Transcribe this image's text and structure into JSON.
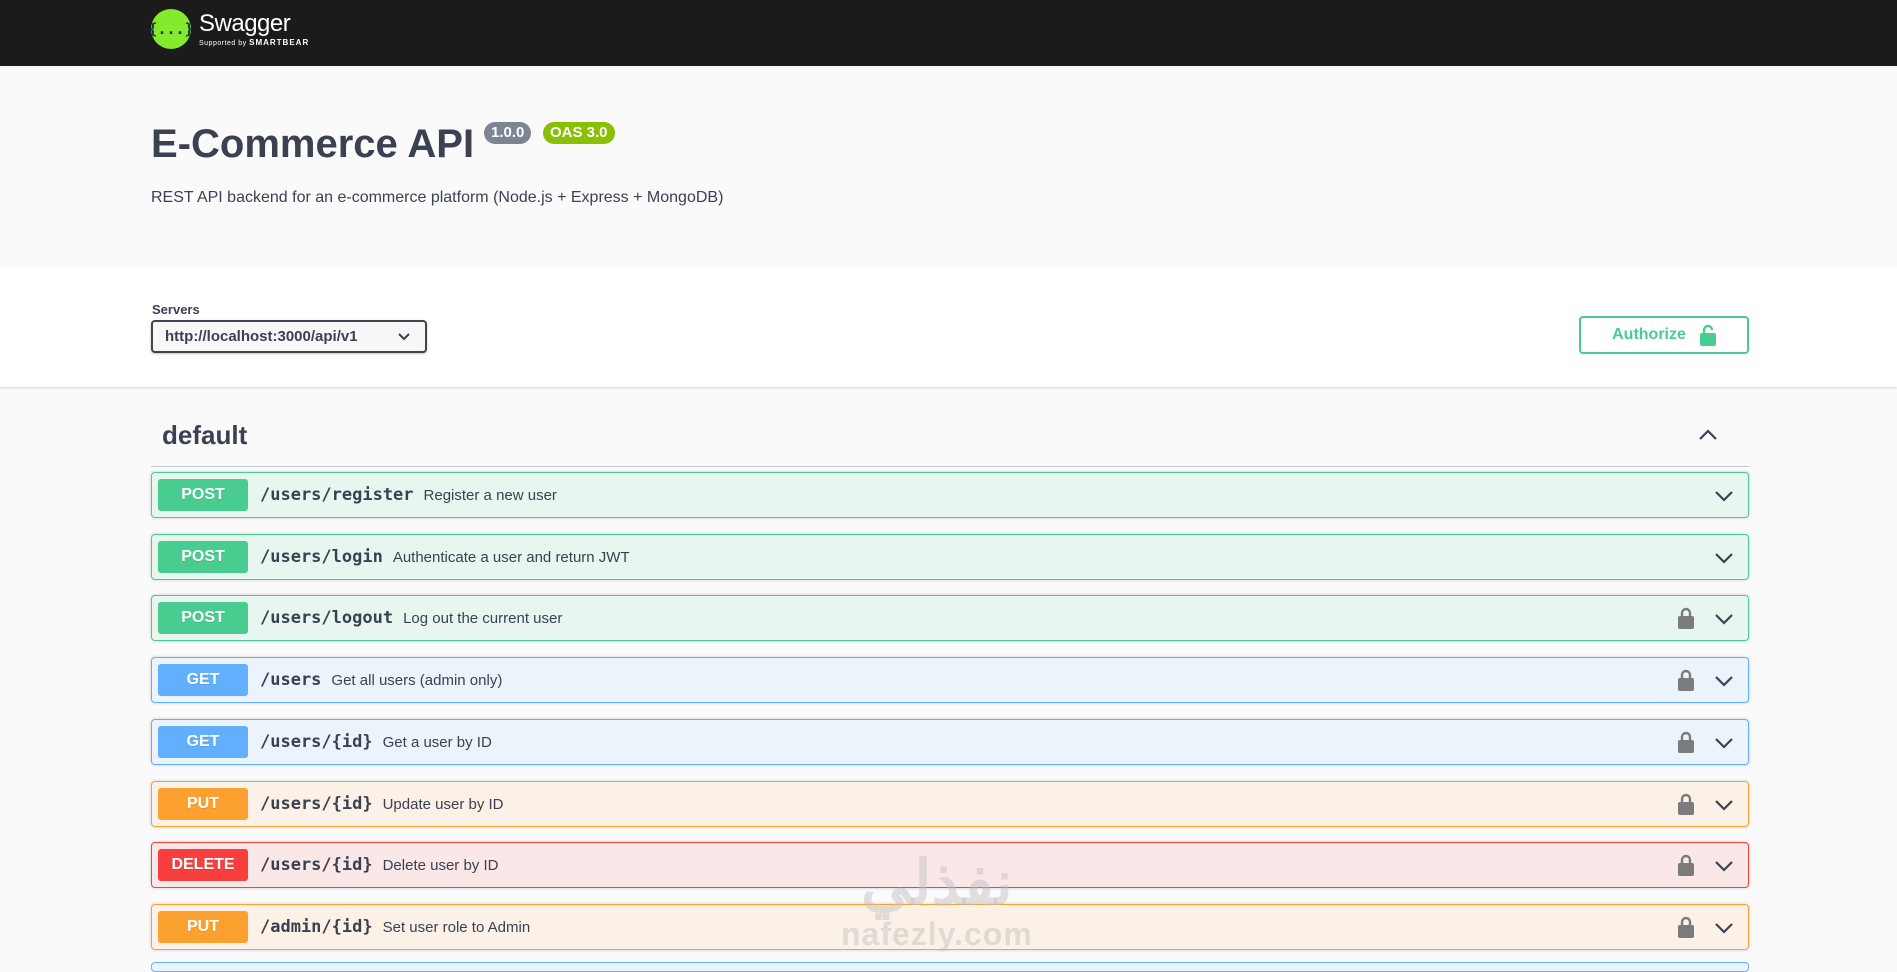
{
  "topbar": {
    "logo_symbol": "{...}",
    "logo_name": "Swagger",
    "logo_supported": "Supported by",
    "logo_brand": "SMARTBEAR"
  },
  "info": {
    "title": "E-Commerce API",
    "version": "1.0.0",
    "oas_version": "OAS 3.0",
    "description": "REST API backend for an e-commerce platform (Node.js + Express + MongoDB)"
  },
  "servers": {
    "label": "Servers",
    "selected": "http://localhost:3000/api/v1"
  },
  "authorize": {
    "label": "Authorize",
    "icon": "unlock-icon"
  },
  "section": {
    "title": "default",
    "toggle_icon": "chevron-up-icon"
  },
  "operations": [
    {
      "method": "POST",
      "path": "/users/register",
      "summary": "Register a new user",
      "locked": false
    },
    {
      "method": "POST",
      "path": "/users/login",
      "summary": "Authenticate a user and return JWT",
      "locked": false
    },
    {
      "method": "POST",
      "path": "/users/logout",
      "summary": "Log out the current user",
      "locked": true
    },
    {
      "method": "GET",
      "path": "/users",
      "summary": "Get all users (admin only)",
      "locked": true
    },
    {
      "method": "GET",
      "path": "/users/{id}",
      "summary": "Get a user by ID",
      "locked": true
    },
    {
      "method": "PUT",
      "path": "/users/{id}",
      "summary": "Update user by ID",
      "locked": true
    },
    {
      "method": "DELETE",
      "path": "/users/{id}",
      "summary": "Delete user by ID",
      "locked": true
    },
    {
      "method": "PUT",
      "path": "/admin/{id}",
      "summary": "Set user role to Admin",
      "locked": true
    }
  ],
  "colors": {
    "post": "#49cc90",
    "get": "#61affe",
    "put": "#fca130",
    "delete": "#f93e3e",
    "topbar": "#1b1b1b"
  },
  "watermark": {
    "arabic": "نفذلي",
    "latin": "nafezly.com"
  }
}
